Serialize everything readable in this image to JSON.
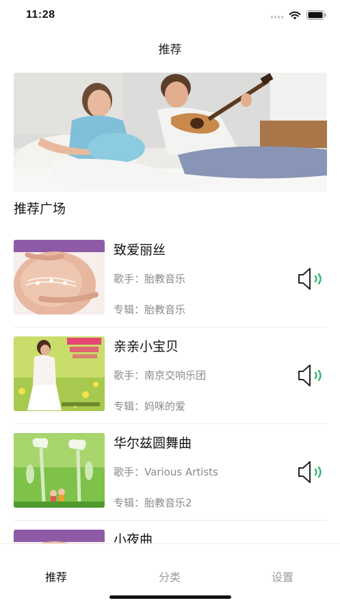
{
  "status_bar": {
    "time": "11:28"
  },
  "nav": {
    "title": "推荐"
  },
  "banner": {
    "image": "couple-with-guitar-photo"
  },
  "section": {
    "title": "推荐广场"
  },
  "songs": [
    {
      "title": "致爱丽丝",
      "artist": "歌手：胎教音乐",
      "album": "专辑：胎教音乐",
      "cover": "pregnant-belly-music-notes"
    },
    {
      "title": "亲亲小宝贝",
      "artist": "歌手：南京交响乐团",
      "album": "专辑：妈咪的爱",
      "cover": "mother-in-flower-field"
    },
    {
      "title": "华尔兹圆舞曲",
      "artist": "歌手：Various Artists",
      "album": "专辑：胎教音乐2",
      "cover": "green-flowers-illustration"
    },
    {
      "title": "小夜曲",
      "artist": "",
      "album": "",
      "cover": "pregnant-belly"
    }
  ],
  "tabs": [
    {
      "label": "推荐",
      "active": true
    },
    {
      "label": "分类",
      "active": false
    },
    {
      "label": "设置",
      "active": false
    }
  ],
  "colors": {
    "accent_green": "#2fb86b",
    "icon_dark": "#222222",
    "meta_gray": "#8a8a8a"
  }
}
